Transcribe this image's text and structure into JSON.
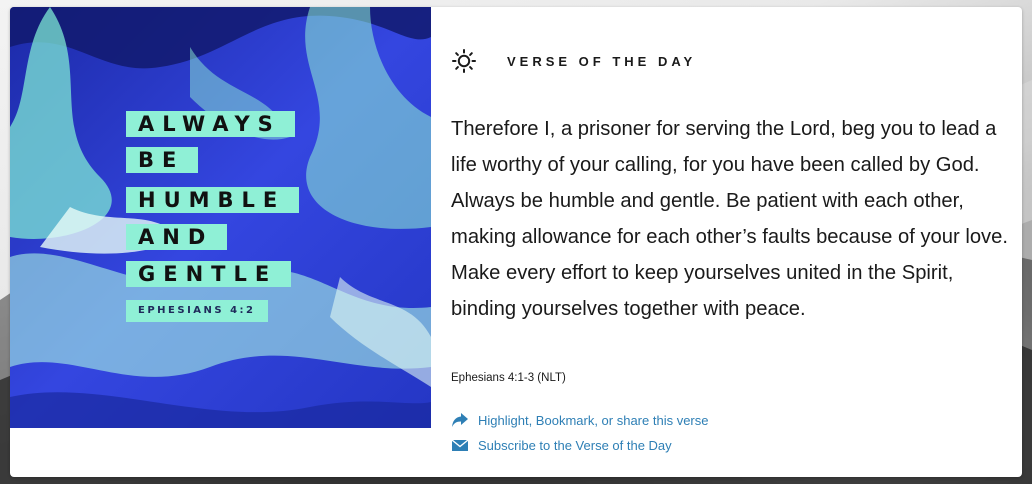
{
  "colors": {
    "link": "#2e7fb5",
    "accent_mint": "#8ff0d6",
    "image_blue": "#2f3fd8",
    "text": "#1a1a1a"
  },
  "verse_image": {
    "lines": [
      "ALWAYS",
      "BE",
      "HUMBLE",
      "AND",
      "GENTLE"
    ],
    "reference": "EPHESIANS 4:2"
  },
  "header": {
    "icon": "sun-icon",
    "title": "VERSE OF THE DAY"
  },
  "verse": {
    "text": "Therefore I, a prisoner for serving the Lord, beg you to lead a life worthy of your calling, for you have been called by God. Always be humble and gentle. Be patient with each other, making allowance for each other’s faults because of your love. Make every effort to keep yourselves united in the Spirit, binding yourselves together with peace.",
    "reference": "Ephesians 4:1-3 (NLT)"
  },
  "actions": {
    "share": {
      "icon": "share-arrow-icon",
      "label": "Highlight, Bookmark, or share this verse"
    },
    "subscribe": {
      "icon": "envelope-icon",
      "label": "Subscribe to the Verse of the Day"
    }
  }
}
